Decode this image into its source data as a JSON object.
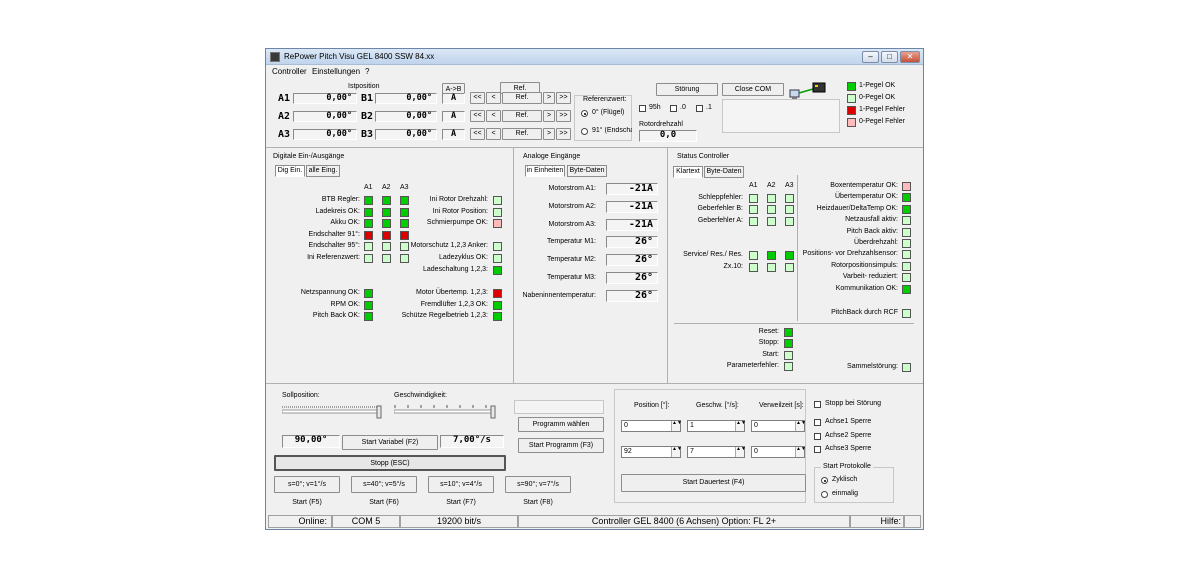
{
  "window": {
    "title": "RePower Pitch Visu   GEL 8400   SSW 84.xx"
  },
  "menu": [
    "Controller",
    "Einstellungen",
    "?"
  ],
  "top": {
    "istposition_label": "Istposition",
    "ab_button": "A->B",
    "ref_button": "Ref.",
    "rows": [
      {
        "a_label": "A1",
        "a_value": "0,00°",
        "b_label": "B1",
        "b_value": "0,00°",
        "mode": "A"
      },
      {
        "a_label": "A2",
        "a_value": "0,00°",
        "b_label": "B2",
        "b_value": "0,00°",
        "mode": "A"
      },
      {
        "a_label": "A3",
        "a_value": "0,00°",
        "b_label": "B3",
        "b_value": "0,00°",
        "mode": "A"
      }
    ],
    "nav": {
      "first": "<<",
      "prev": "<",
      "ref": "Ref.",
      "next": ">",
      "last": ">>"
    },
    "referenzwert": {
      "label": "Referenzwert:",
      "opt1": "0° (Flügel)",
      "opt2": "91° (Endscha"
    },
    "checks": [
      "95h",
      ".0",
      ".1"
    ],
    "rotordrehzahl": {
      "label": "Rotordrehzahl",
      "value": "0,0"
    },
    "stoerung_button": "Störung",
    "close_com_button": "Close COM",
    "legend": [
      {
        "label": "1-Pegel OK",
        "color": "#00cc00"
      },
      {
        "label": "0-Pegel OK",
        "color": "#ccffcc"
      },
      {
        "label": "1-Pegel Fehler",
        "color": "#dd0000"
      },
      {
        "label": "0-Pegel Fehler",
        "color": "#ffbbbb"
      }
    ]
  },
  "digital": {
    "title": "Digitale Ein-/Ausgänge",
    "tabs": [
      "Dig Ein.",
      "alle Eing."
    ],
    "headers": [
      "A1",
      "A2",
      "A3"
    ],
    "left_rows": [
      {
        "label": "BTB Regler:",
        "leds": [
          "#00cc00",
          "#00cc00",
          "#00cc00"
        ]
      },
      {
        "label": "Ladekreis OK:",
        "leds": [
          "#00cc00",
          "#00cc00",
          "#00cc00"
        ]
      },
      {
        "label": "Akku OK:",
        "leds": [
          "#00cc00",
          "#00cc00",
          "#00cc00"
        ]
      },
      {
        "label": "Endschalter 91°:",
        "leds": [
          "#dd0000",
          "#dd0000",
          "#dd0000"
        ]
      },
      {
        "label": "Endschalter 95°:",
        "leds": [
          "#ccffcc",
          "#ccffcc",
          "#ccffcc"
        ]
      },
      {
        "label": "Ini Referenzwert:",
        "leds": [
          "#ccffcc",
          "#ccffcc",
          "#ccffcc"
        ]
      }
    ],
    "right_rows": [
      {
        "label": "Ini Rotor Drehzahl:",
        "color": "#ccffcc"
      },
      {
        "label": "Ini Rotor Position:",
        "color": "#ccffcc"
      },
      {
        "label": "Schmierpumpe OK:",
        "color": "#ffbbbb"
      },
      {
        "label": "",
        "color": ""
      },
      {
        "label": "Motorschutz 1,2,3 Anker:",
        "color": "#ccffcc"
      },
      {
        "label": "Ladezyklus OK:",
        "color": "#ccffcc"
      },
      {
        "label": "Ladeschaltung 1,2,3:",
        "color": "#00cc00"
      }
    ],
    "left_bottom": [
      {
        "label": "Netzspannung OK:",
        "color": "#00cc00"
      },
      {
        "label": "RPM OK:",
        "color": "#00cc00"
      },
      {
        "label": "Pitch Back OK:",
        "color": "#00cc00"
      }
    ],
    "right_bottom": [
      {
        "label": "Motor Übertemp. 1,2,3:",
        "color": "#dd0000"
      },
      {
        "label": "Fremdlüfter 1,2,3 OK:",
        "color": "#00cc00"
      },
      {
        "label": "Schütze Regelbetrieb 1,2,3:",
        "color": "#00cc00"
      }
    ]
  },
  "analog": {
    "title": "Analoge Eingänge",
    "tabs": [
      "in Einheiten",
      "Byte-Daten"
    ],
    "rows": [
      {
        "label": "Motorstrom A1:",
        "value": "-21A"
      },
      {
        "label": "Motorstrom A2:",
        "value": "-21A"
      },
      {
        "label": "Motorstrom A3:",
        "value": "-21A"
      },
      {
        "label": "Temperatur M1:",
        "value": "26°"
      },
      {
        "label": "Temperatur M2:",
        "value": "26°"
      },
      {
        "label": "Temperatur M3:",
        "value": "26°"
      },
      {
        "label": "Nabeninnentemperatur:",
        "value": "26°"
      }
    ]
  },
  "status": {
    "title": "Status Controller",
    "tabs": [
      "Klartext",
      "Byte-Daten"
    ],
    "headers": [
      "A1",
      "A2",
      "A3"
    ],
    "axis_rows": [
      {
        "label": "Schleppfehler:",
        "leds": [
          "#ccffcc",
          "#ccffcc",
          "#ccffcc"
        ]
      },
      {
        "label": "Geberfehler B:",
        "leds": [
          "#ccffcc",
          "#ccffcc",
          "#ccffcc"
        ]
      },
      {
        "label": "Geberfehler A:",
        "leds": [
          "#ccffcc",
          "#ccffcc",
          "#ccffcc"
        ]
      },
      {
        "label": "Service/ Res./ Res.",
        "leds": [
          "#ccffcc",
          "#00cc00",
          "#00cc00"
        ]
      },
      {
        "label": "Zx.10:",
        "leds": [
          "#ccffcc",
          "#ccffcc",
          "#ccffcc"
        ]
      }
    ],
    "right_rows": [
      {
        "label": "Boxentemperatur OK:",
        "color": "#ffbbbb"
      },
      {
        "label": "Übertemperatur OK:",
        "color": "#00cc00"
      },
      {
        "label": "Heizdauer/DeltaTemp OK:",
        "color": "#00cc00"
      },
      {
        "label": "Netzausfall aktiv:",
        "color": "#ccffcc"
      },
      {
        "label": "Pitch Back aktiv:",
        "color": "#ccffcc"
      },
      {
        "label": "Überdrehzahl:",
        "color": "#ccffcc"
      },
      {
        "label": "Positions- vor Drehzahlsensor:",
        "color": "#ccffcc"
      },
      {
        "label": "Rotorpositionsimpuls:",
        "color": "#ccffcc"
      },
      {
        "label": "Varbeit- reduziert:",
        "color": "#ccffcc"
      },
      {
        "label": "Kommunikation OK:",
        "color": "#00cc00"
      }
    ],
    "pitchback_rcf": {
      "label": "PitchBack durch RCF",
      "color": "#ccffcc"
    },
    "bottom_rows": [
      {
        "label": "Reset:",
        "color": "#00cc00"
      },
      {
        "label": "Stopp:",
        "color": "#00cc00"
      },
      {
        "label": "Start:",
        "color": "#ccffcc"
      },
      {
        "label": "Parameterfehler:",
        "color": "#ccffcc"
      }
    ],
    "sammelstoerung": {
      "label": "Sammelstörung:",
      "color": "#ccffcc"
    }
  },
  "control": {
    "sollposition_label": "Sollposition:",
    "geschwindigkeit_label": "Geschwindigkeit:",
    "soll_value": "90,00°",
    "start_variabel": "Start Variabel (F2)",
    "speed_value": "7,00°/s",
    "stopp_button": "Stopp (ESC)",
    "presets": [
      {
        "label": "s=0°; v=1°/s",
        "start": "Start (F5)"
      },
      {
        "label": "s=40°; v=5°/s",
        "start": "Start (F6)"
      },
      {
        "label": "s=10°; v=4°/s",
        "start": "Start (F7)"
      },
      {
        "label": "s=90°; v=7°/s",
        "start": "Start (F8)"
      }
    ],
    "programm_waehlen": "Programm wählen",
    "start_programm": "Start Programm (F3)"
  },
  "dauertest": {
    "headers": [
      "Position [°]:",
      "Geschw. [°/s]:",
      "Verweilzeit [s]:"
    ],
    "rows": [
      {
        "position": "0",
        "speed": "1",
        "wait": "0"
      },
      {
        "position": "92",
        "speed": "7",
        "wait": "0"
      }
    ],
    "start_button": "Start Dauertest (F4)",
    "checks": [
      {
        "label": "Stopp bei Störung"
      },
      {
        "label": "Achse1 Sperre"
      },
      {
        "label": "Achse2 Sperre"
      },
      {
        "label": "Achse3 Sperre"
      }
    ],
    "protokoll": {
      "label": "Start Protokolle",
      "opt1": "Zyklisch",
      "opt2": "einmalig"
    }
  },
  "statusbar": {
    "online": "Online:",
    "com": "COM 5",
    "baud": "19200 bit/s",
    "controller": "Controller GEL 8400 (6 Achsen) Option: FL 2+",
    "hilfe": "Hilfe:"
  }
}
